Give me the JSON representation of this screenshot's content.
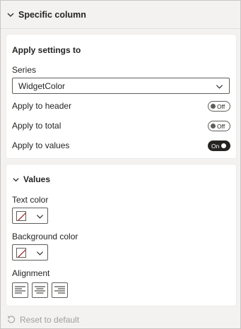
{
  "section": {
    "title": "Specific column"
  },
  "apply_settings": {
    "title": "Apply settings to",
    "series_label": "Series",
    "series_value": "WidgetColor",
    "rows": [
      {
        "label": "Apply to header",
        "state": "Off"
      },
      {
        "label": "Apply to total",
        "state": "Off"
      },
      {
        "label": "Apply to values",
        "state": "On"
      }
    ]
  },
  "values": {
    "title": "Values",
    "text_color_label": "Text color",
    "background_color_label": "Background color",
    "alignment_label": "Alignment"
  },
  "footer": {
    "reset_label": "Reset to default"
  },
  "colors": {
    "accent_dark": "#252423",
    "border": "#605e5c",
    "disabled_text": "#a19f9d",
    "no_color_slash": "#a4262c"
  }
}
